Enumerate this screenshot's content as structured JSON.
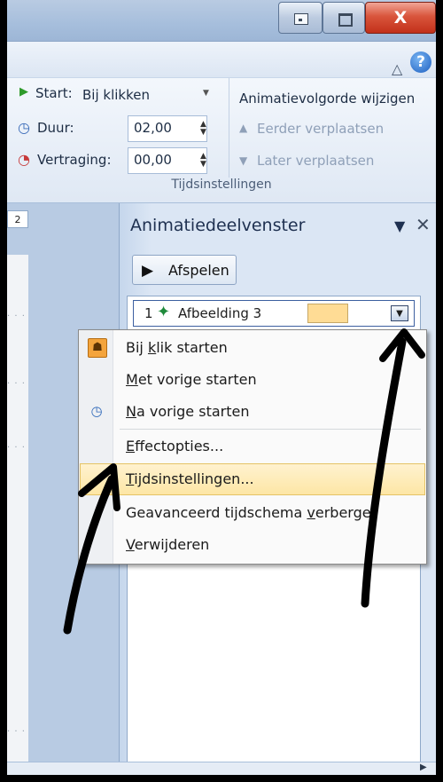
{
  "window": {
    "close_label": "X"
  },
  "ribbon": {
    "start_label": "Start:",
    "start_value": "Bij klikken",
    "duration_label": "Duur:",
    "duration_value": "02,00",
    "delay_label": "Vertraging:",
    "delay_value": "00,00",
    "reorder_title": "Animatievolgorde wijzigen",
    "move_earlier": "Eerder verplaatsen",
    "move_later": "Later verplaatsen",
    "group_label": "Tijdsinstellingen",
    "help_glyph": "?"
  },
  "slide": {
    "thumb_number": "2"
  },
  "pane": {
    "title": "Animatiedeelvenster",
    "play_label": "Afspelen",
    "item": {
      "number": "1",
      "label": "Afbeelding 3",
      "bar_color": "#ffdc95"
    }
  },
  "menu": {
    "items": [
      {
        "pre": "Bij ",
        "key": "k",
        "post": "lik starten",
        "icon": "mouse-icon"
      },
      {
        "pre": "",
        "key": "M",
        "post": "et vorige starten"
      },
      {
        "pre": "",
        "key": "N",
        "post": "a vorige starten",
        "icon": "clock-icon"
      },
      {
        "pre": "",
        "key": "E",
        "post": "ffectopties..."
      },
      {
        "pre": "",
        "key": "T",
        "post": "ijdsinstellingen..."
      },
      {
        "pre": "Geavanceerd tijdschema ",
        "key": "v",
        "post": "erberge"
      },
      {
        "pre": "",
        "key": "V",
        "post": "erwijderen"
      }
    ],
    "highlight_color": "#fde6a5"
  }
}
